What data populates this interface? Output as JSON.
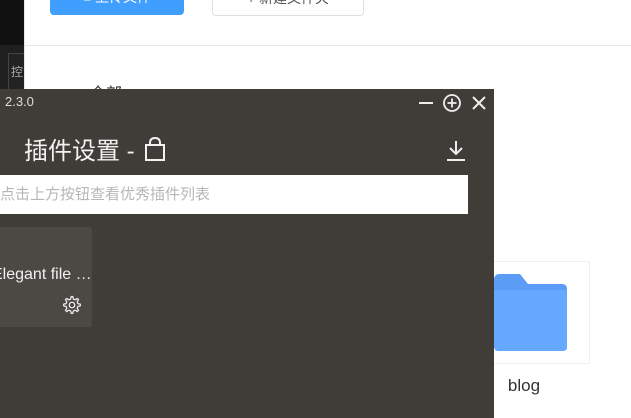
{
  "background_app": {
    "upload_button": "≡ 上传文件",
    "new_folder_button": "+ 新建文件夹",
    "breadcrumb": "全部",
    "left_tab_char": "控",
    "folder": {
      "name": "blog",
      "color": "#64a8ff"
    }
  },
  "panel": {
    "version": "2.3.0",
    "title": "插件设置 -",
    "search_placeholder": "点击上方按钮查看优秀插件列表",
    "plugin_card": {
      "name": "Elegant file …"
    },
    "icons": {
      "minimize": "minimize-icon",
      "pin": "plus-circle-icon",
      "close": "close-icon",
      "bag": "shopping-bag-icon",
      "download": "download-icon",
      "settings": "gear-icon"
    },
    "colors": {
      "background": "#403c38",
      "card": "#4c4844",
      "accent": "#409eff"
    }
  }
}
